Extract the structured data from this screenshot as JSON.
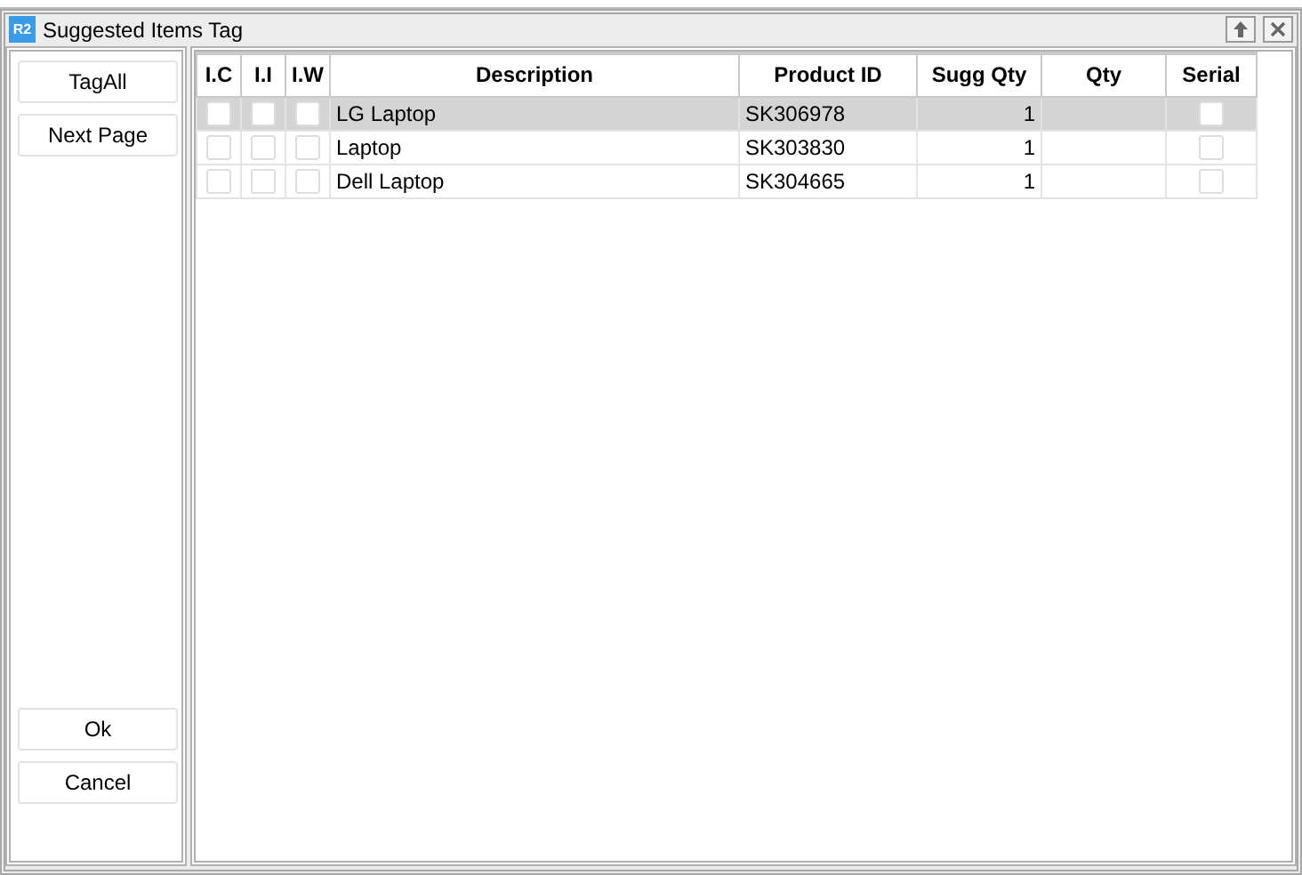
{
  "window": {
    "title": "Suggested Items Tag",
    "badge": "R2"
  },
  "sidebar": {
    "top_buttons": [
      "TagAll",
      "Next Page"
    ],
    "bottom_buttons": [
      "Ok",
      "Cancel"
    ]
  },
  "table": {
    "columns": [
      "I.C",
      "I.I",
      "I.W",
      "Description",
      "Product ID",
      "Sugg Qty",
      "Qty",
      "Serial"
    ],
    "rows": [
      {
        "selected": true,
        "ic": false,
        "ii": false,
        "iw": false,
        "description": "LG Laptop",
        "product_id": "SK306978",
        "sugg_qty": "1",
        "serial": false
      },
      {
        "selected": false,
        "ic": false,
        "ii": false,
        "iw": false,
        "description": "Laptop",
        "product_id": "SK303830",
        "sugg_qty": "1",
        "serial": false
      },
      {
        "selected": false,
        "ic": false,
        "ii": false,
        "iw": false,
        "description": "Dell Laptop",
        "product_id": "SK304665",
        "sugg_qty": "1",
        "serial": false
      }
    ]
  }
}
